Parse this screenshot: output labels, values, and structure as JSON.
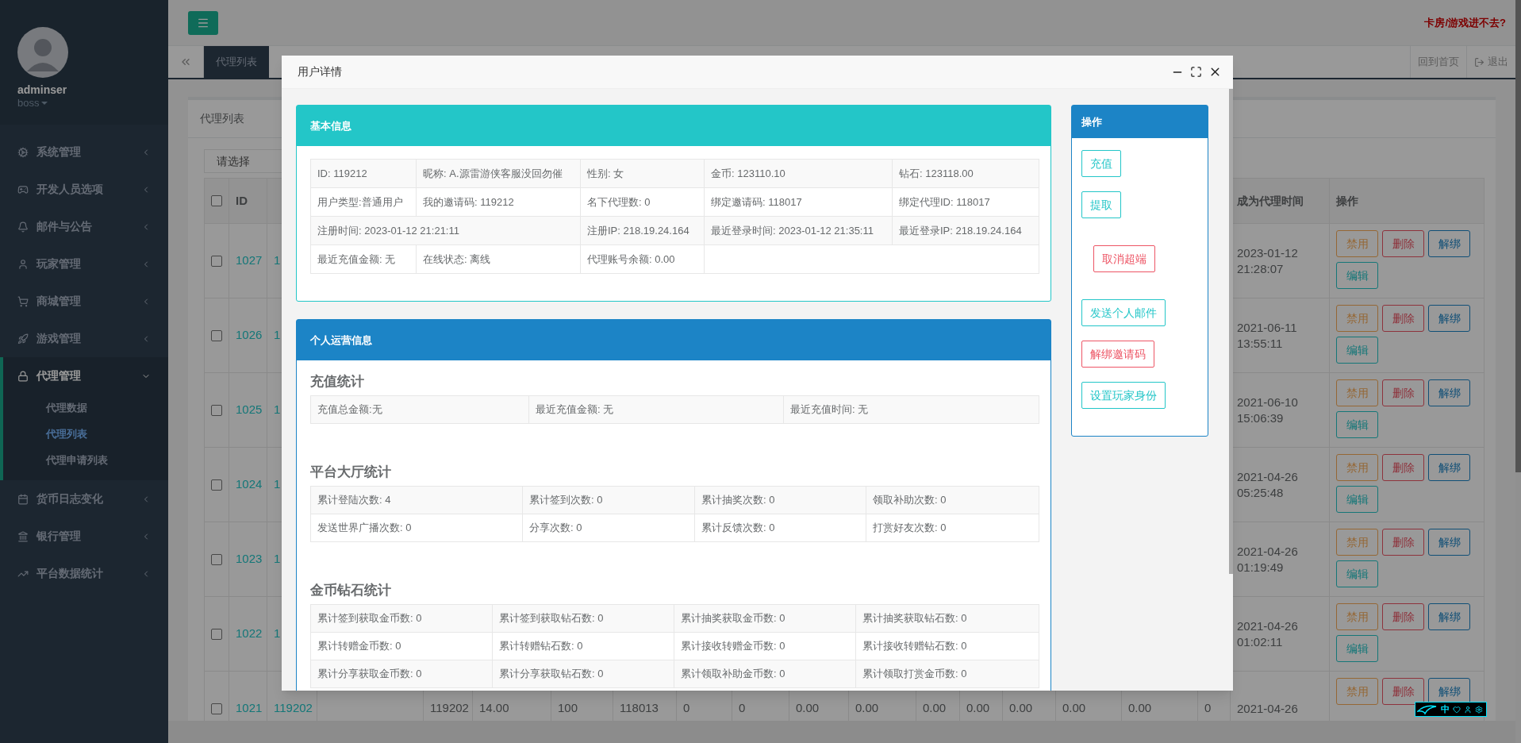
{
  "sidebar": {
    "user": {
      "name": "adminser",
      "role": "boss"
    },
    "menu": [
      {
        "label": "系统管理",
        "expanded": false
      },
      {
        "label": "开发人员选项",
        "expanded": false
      },
      {
        "label": "邮件与公告",
        "expanded": false
      },
      {
        "label": "玩家管理",
        "expanded": false
      },
      {
        "label": "商城管理",
        "expanded": false
      },
      {
        "label": "游戏管理",
        "expanded": false
      },
      {
        "label": "代理管理",
        "expanded": true,
        "children": [
          {
            "label": "代理数据",
            "selected": false
          },
          {
            "label": "代理列表",
            "selected": true
          },
          {
            "label": "代理申请列表",
            "selected": false
          }
        ]
      },
      {
        "label": "货币日志变化",
        "expanded": false
      },
      {
        "label": "银行管理",
        "expanded": false
      },
      {
        "label": "平台数据统计",
        "expanded": false
      }
    ]
  },
  "header": {
    "notice": "卡房/游戏进不去?"
  },
  "tabs": [
    {
      "label": "代理列表",
      "selected": true
    }
  ],
  "tab_bar_actions": [
    {
      "label": "回到首页",
      "kind": "link"
    },
    {
      "label": "退出",
      "kind": "logout"
    }
  ],
  "panel": {
    "title": "代理列表",
    "select": {
      "placeholder": "请选择"
    },
    "table": {
      "select_all_checked": false,
      "columns": {
        "id": "ID",
        "join_time": "成为代理时间",
        "actions": "操作"
      },
      "rows": [
        {
          "id": "1027",
          "checked": false,
          "column_3": "1",
          "join_time": "2023-01-12 21:28:07",
          "actions": [
            {
              "label": "禁用",
              "kind": "warning"
            },
            {
              "label": "删除",
              "kind": "danger"
            },
            {
              "label": "解绑",
              "kind": "primary"
            },
            {
              "label": "编辑",
              "kind": "info"
            }
          ]
        },
        {
          "id": "1026",
          "checked": false,
          "column_3": "1",
          "join_time": "2021-06-11 13:55:11",
          "actions": [
            {
              "label": "禁用",
              "kind": "warning"
            },
            {
              "label": "删除",
              "kind": "danger"
            },
            {
              "label": "解绑",
              "kind": "primary"
            },
            {
              "label": "编辑",
              "kind": "info"
            }
          ]
        },
        {
          "id": "1025",
          "checked": false,
          "column_3": "1",
          "join_time": "2021-06-10 15:06:39",
          "actions": [
            {
              "label": "禁用",
              "kind": "warning"
            },
            {
              "label": "删除",
              "kind": "danger"
            },
            {
              "label": "解绑",
              "kind": "primary"
            },
            {
              "label": "编辑",
              "kind": "info"
            }
          ]
        },
        {
          "id": "1024",
          "checked": false,
          "column_3": "1",
          "join_time": "2021-04-26 05:25:48",
          "actions": [
            {
              "label": "禁用",
              "kind": "warning"
            },
            {
              "label": "删除",
              "kind": "danger"
            },
            {
              "label": "解绑",
              "kind": "primary"
            },
            {
              "label": "编辑",
              "kind": "info"
            }
          ]
        },
        {
          "id": "1023",
          "checked": false,
          "column_3": "1",
          "join_time": "2021-04-26 01:19:49",
          "actions": [
            {
              "label": "禁用",
              "kind": "warning"
            },
            {
              "label": "删除",
              "kind": "danger"
            },
            {
              "label": "解绑",
              "kind": "primary"
            },
            {
              "label": "编辑",
              "kind": "info"
            }
          ]
        },
        {
          "id": "1022",
          "checked": false,
          "column_3": "1",
          "join_time": "2021-04-26 01:02:11",
          "actions": [
            {
              "label": "禁用",
              "kind": "warning"
            },
            {
              "label": "删除",
              "kind": "danger"
            },
            {
              "label": "解绑",
              "kind": "primary"
            },
            {
              "label": "编辑",
              "kind": "info"
            }
          ]
        },
        {
          "id": "1021",
          "checked": false,
          "column_3": "119202",
          "cells": {
            "column_5": "119202",
            "column_6": "14.00",
            "column_7": "100",
            "column_8": "118013",
            "column_9": "0",
            "column_10": "0",
            "column_11": "0.00",
            "column_12": "0.00",
            "column_13": "0.00",
            "column_14": "0.00",
            "column_15": "0.00",
            "column_16": "0.00",
            "column_17": "0.00",
            "column_18": "0"
          },
          "join_time": "2021-04-26",
          "actions": [
            {
              "label": "禁用",
              "kind": "warning"
            },
            {
              "label": "删除",
              "kind": "danger"
            },
            {
              "label": "解绑",
              "kind": "primary"
            }
          ]
        }
      ]
    }
  },
  "modal": {
    "title": "用户详情",
    "basic_info": {
      "title": "基本信息",
      "rows": [
        [
          {
            "text": "ID: 119212"
          },
          {
            "text": "昵称: A.源雷游侠客服没回勿催"
          },
          {
            "text": "性别: 女"
          },
          {
            "text": "金币: 123110.10"
          },
          {
            "text": "钻石: 123118.00"
          }
        ],
        [
          {
            "text": "用户类型:普通用户"
          },
          {
            "text": "我的邀请码: 119212"
          },
          {
            "text": "名下代理数: 0"
          },
          {
            "text": "绑定邀请码: 118017"
          },
          {
            "text": "绑定代理ID: 118017"
          }
        ],
        [
          {
            "text": "注册时间: 2023-01-12 21:21:11",
            "colspan": 2
          },
          {
            "text": "注册IP: 218.19.24.164"
          },
          {
            "text": "最近登录时间: 2023-01-12 21:35:11"
          },
          {
            "text": "最近登录IP: 218.19.24.164"
          }
        ],
        [
          {
            "text": "最近充值金额: 无"
          },
          {
            "text": "在线状态: 离线"
          },
          {
            "text": "代理账号余额: 0.00"
          }
        ]
      ]
    },
    "operations": {
      "title": "个人运营信息",
      "sections": [
        {
          "title": "充值统计",
          "rows": [
            [
              "充值总金额:无",
              "最近充值金额: 无",
              "最近充值时间: 无"
            ]
          ]
        },
        {
          "title": "平台大厅统计",
          "rows": [
            [
              "累计登陆次数: 4",
              "累计签到次数: 0",
              "累计抽奖次数: 0",
              "领取补助次数: 0"
            ],
            [
              "发送世界广播次数: 0",
              "分享次数: 0",
              "累计反馈次数: 0",
              "打赏好友次数: 0"
            ]
          ]
        },
        {
          "title": "金币钻石统计",
          "rows": [
            [
              "累计签到获取金币数: 0",
              "累计签到获取钻石数: 0",
              "累计抽奖获取金币数: 0",
              "累计抽奖获取钻石数: 0"
            ],
            [
              "累计转赠金币数: 0",
              "累计转赠钻石数: 0",
              "累计接收转赠金币数: 0",
              "累计接收转赠钻石数: 0"
            ],
            [
              "累计分享获取金币数: 0",
              "累计分享获取钻石数: 0",
              "累计领取补助金币数: 0",
              "累计领取打赏金币数: 0"
            ]
          ]
        }
      ]
    },
    "actions": {
      "title": "操作",
      "buttons": [
        {
          "label": "充值",
          "kind": "info"
        },
        {
          "label": "提取",
          "kind": "info"
        },
        {
          "label": "取消超端",
          "kind": "danger"
        },
        {
          "label": "发送个人邮件",
          "kind": "info"
        },
        {
          "label": "解绑邀请码",
          "kind": "danger"
        },
        {
          "label": "设置玩家身份",
          "kind": "info"
        }
      ]
    }
  },
  "ime_indicator": {
    "label": "中"
  }
}
